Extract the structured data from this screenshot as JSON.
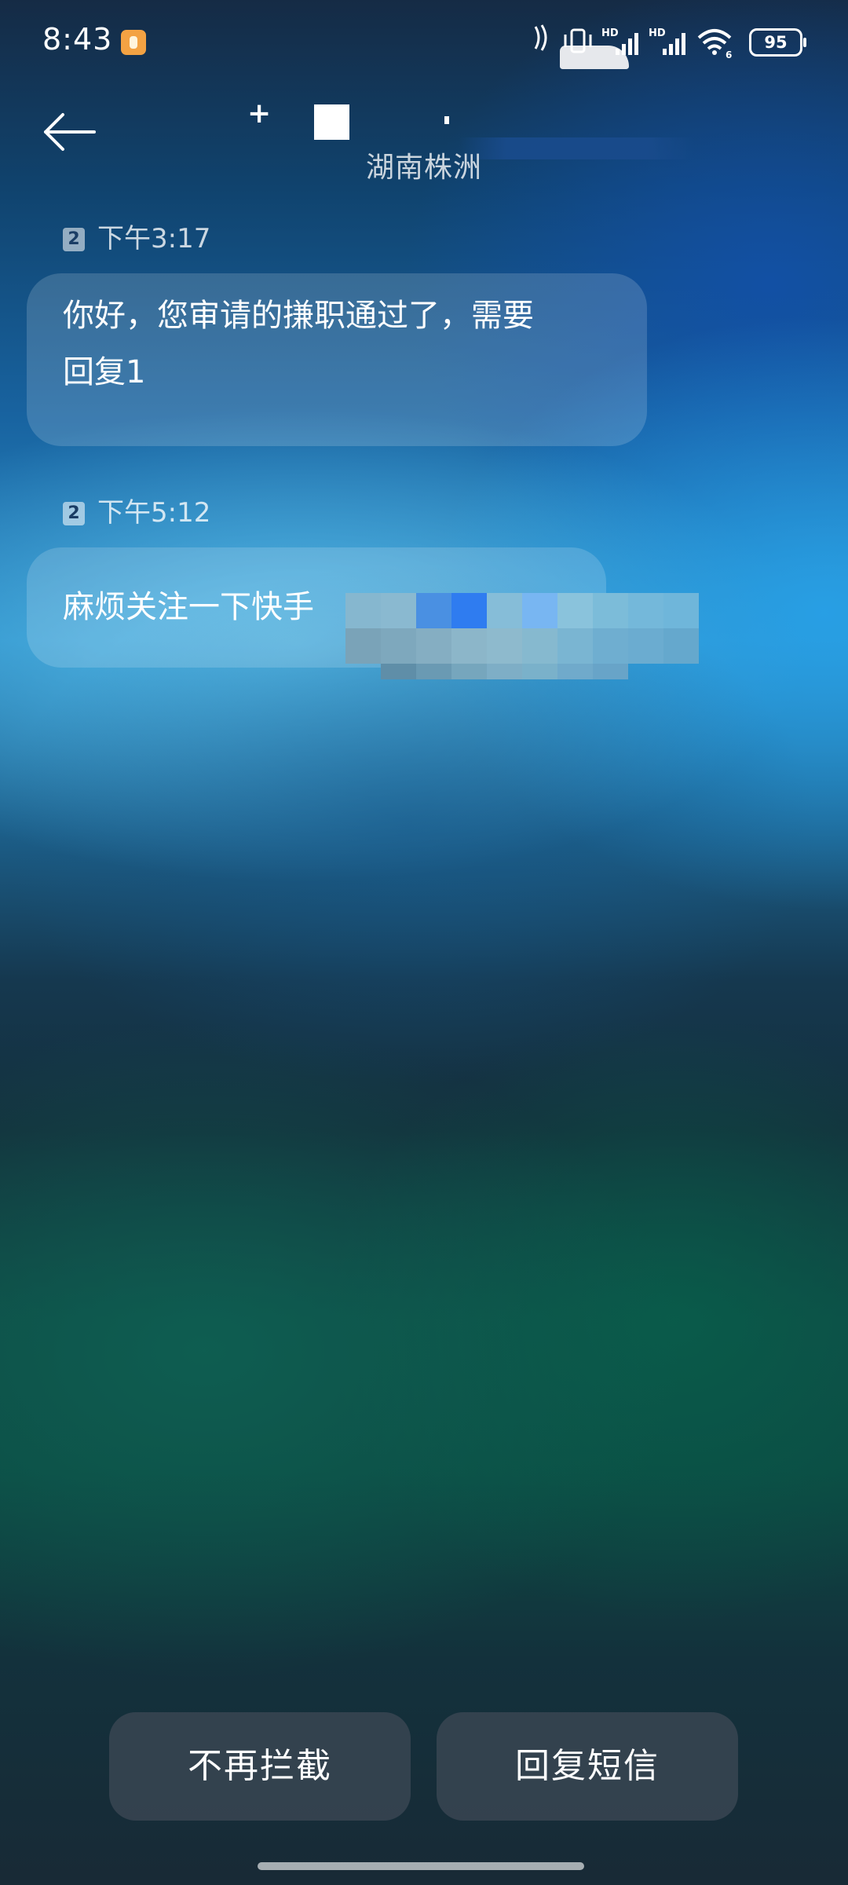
{
  "status_bar": {
    "time": "8:43",
    "app_icon": "notification-app-icon",
    "signal_1_label": "HD",
    "signal_2_label": "HD",
    "wifi_label": "6",
    "battery": "95"
  },
  "header": {
    "back_icon": "arrow-left-icon",
    "title_prefix": "+",
    "location": "湖南株洲"
  },
  "messages": [
    {
      "sim": "2",
      "time": "下午3:17",
      "text_line_1": "你好，您审请的搛职通过了，需要",
      "text_line_2": "回复1"
    },
    {
      "sim": "2",
      "time": "下午5:12",
      "text": "麻烦关注一下快手"
    }
  ],
  "actions": {
    "unblock": "不再拦截",
    "reply": "回复短信"
  },
  "colors": {
    "bubble": "rgba(255,255,255,0.16)",
    "button": "#3c4854",
    "text": "#ffffff"
  }
}
